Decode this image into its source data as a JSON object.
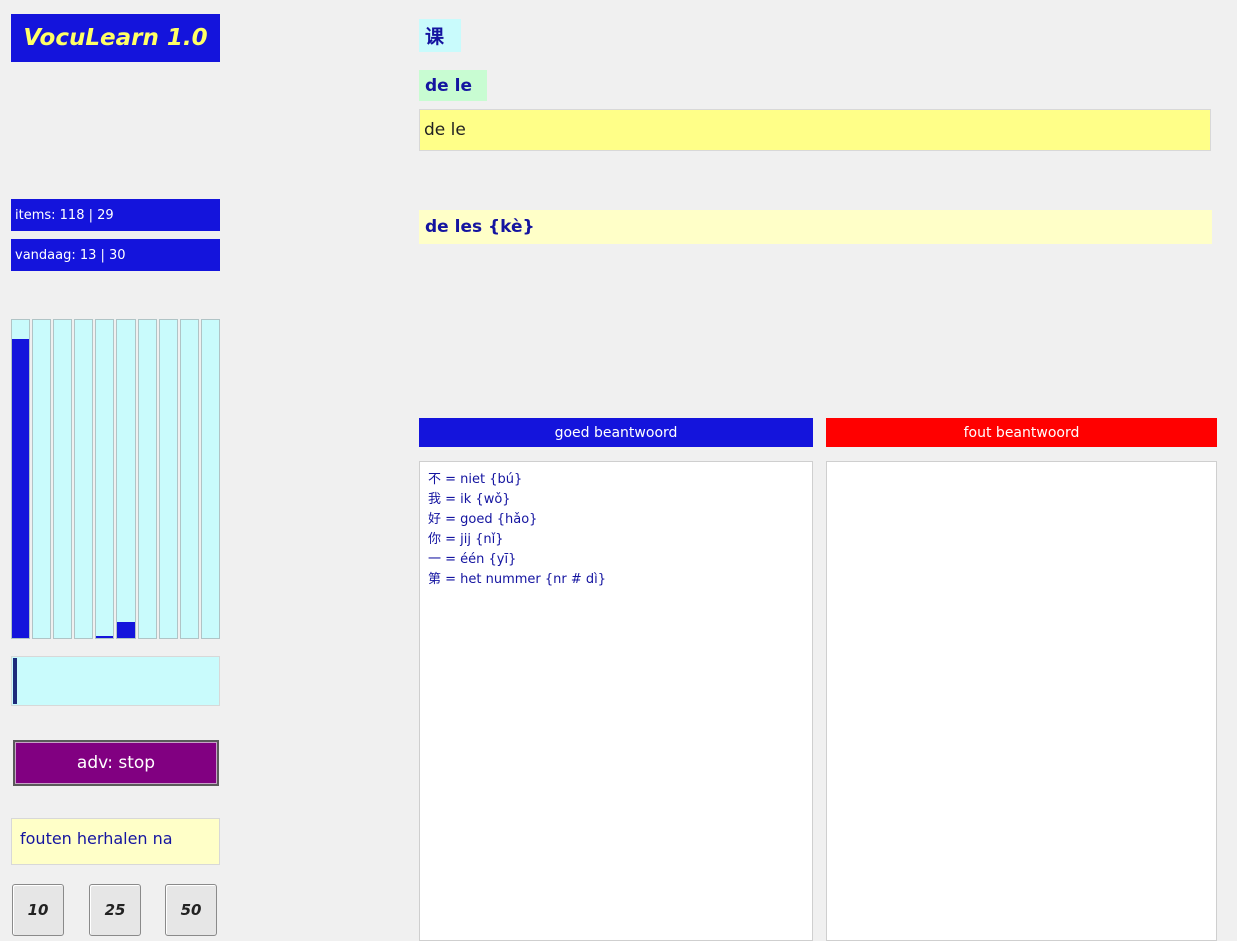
{
  "app": {
    "title": "VocuLearn 1.0"
  },
  "stats": {
    "items": "items: 118 | 29",
    "today": "vandaag: 13 | 30"
  },
  "histogram": {
    "levels": [
      0.94,
      0,
      0,
      0,
      0.005,
      0.05,
      0,
      0,
      0,
      0
    ]
  },
  "progress": {
    "fraction": 0.02
  },
  "controls": {
    "adv_button": "adv: stop",
    "repeat_label": "fouten herhalen na",
    "repeat_options": [
      "10",
      "25",
      "50"
    ]
  },
  "question": {
    "hanzi": "课",
    "pinyin": "de le",
    "answer_value": "de le",
    "solution": "de les {kè}"
  },
  "results": {
    "correct_header": "goed beantwoord",
    "wrong_header": "fout beantwoord",
    "correct_items": [
      "不 = niet {bú}",
      "我 = ik {wǒ}",
      "好 = goed {hǎo}",
      "你 = jij {nǐ}",
      "一 = één {yī}",
      "第 = het nummer  {nr # dì}"
    ],
    "wrong_items": []
  },
  "colors": {
    "accent_blue": "#1414dc",
    "wrong_red": "#ff0000",
    "adv_purple": "#810081",
    "histogram_bg": "#c9fbfc",
    "answer_yellow": "#ffff88"
  }
}
